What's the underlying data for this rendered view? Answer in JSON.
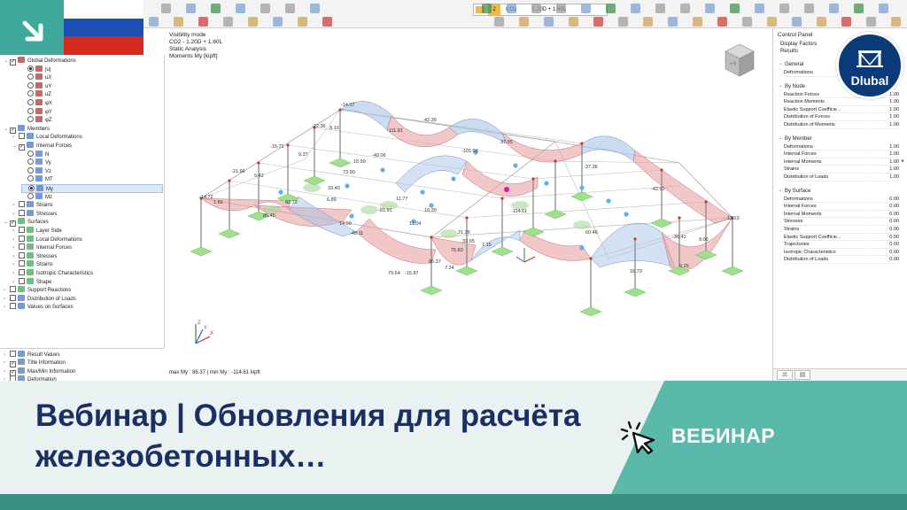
{
  "toolbar": {
    "load_combo": {
      "number": "2",
      "code": "CO2",
      "description": "1.20D + 1.60L"
    }
  },
  "navigator": {
    "rows": [
      {
        "label": "Global Deformations",
        "level": 0,
        "type": "check",
        "checked": true,
        "expanded": true,
        "icon_color": "#a83c3c"
      },
      {
        "label": "|u|",
        "level": 2,
        "type": "radio",
        "on": true,
        "icon_color": "#a83c3c"
      },
      {
        "label": "uX",
        "level": 2,
        "type": "radio",
        "on": false,
        "icon_color": "#a83c3c"
      },
      {
        "label": "uY",
        "level": 2,
        "type": "radio",
        "on": false,
        "icon_color": "#a83c3c"
      },
      {
        "label": "uZ",
        "level": 2,
        "type": "radio",
        "on": false,
        "icon_color": "#a83c3c"
      },
      {
        "label": "φX",
        "level": 2,
        "type": "radio",
        "on": false,
        "icon_color": "#a83c3c"
      },
      {
        "label": "φY",
        "level": 2,
        "type": "radio",
        "on": false,
        "icon_color": "#a83c3c"
      },
      {
        "label": "φZ",
        "level": 2,
        "type": "radio",
        "on": false,
        "icon_color": "#a83c3c"
      },
      {
        "label": "Members",
        "level": 0,
        "type": "check",
        "checked": true,
        "expanded": true,
        "icon_color": "#4a78c8"
      },
      {
        "label": "Local Deformations",
        "level": 1,
        "type": "check",
        "checked": false,
        "expanded": false,
        "icon_color": "#4a78c8"
      },
      {
        "label": "Internal Forces",
        "level": 1,
        "type": "check",
        "checked": true,
        "expanded": true,
        "icon_color": "#4a78c8"
      },
      {
        "label": "N",
        "level": 2,
        "type": "radio",
        "on": false,
        "icon_color": "#4a78c8"
      },
      {
        "label": "Vy",
        "level": 2,
        "type": "radio",
        "on": false,
        "icon_color": "#4a78c8"
      },
      {
        "label": "Vz",
        "level": 2,
        "type": "radio",
        "on": false,
        "icon_color": "#4a78c8"
      },
      {
        "label": "MT",
        "level": 2,
        "type": "radio",
        "on": false,
        "icon_color": "#4a78c8"
      },
      {
        "label": "My",
        "level": 2,
        "type": "radio",
        "on": true,
        "selected": true,
        "icon_color": "#4a78c8"
      },
      {
        "label": "Mz",
        "level": 2,
        "type": "radio",
        "on": false,
        "icon_color": "#4a78c8"
      },
      {
        "label": "Strains",
        "level": 1,
        "type": "check",
        "checked": false,
        "expanded": false,
        "icon_color": "#4a78c8"
      },
      {
        "label": "Stresses",
        "level": 1,
        "type": "check",
        "checked": false,
        "expanded": false,
        "icon_color": "#4a78c8"
      },
      {
        "label": "Surfaces",
        "level": 0,
        "type": "check",
        "checked": true,
        "expanded": true,
        "icon_color": "#3fa85a"
      },
      {
        "label": "Layer Side",
        "level": 1,
        "type": "check",
        "checked": false,
        "expanded": false,
        "icon_color": "#3fa85a"
      },
      {
        "label": "Local Deformations",
        "level": 1,
        "type": "check",
        "checked": false,
        "expanded": false,
        "icon_color": "#3fa85a"
      },
      {
        "label": "Internal Forces",
        "level": 1,
        "type": "check",
        "checked": false,
        "expanded": false,
        "icon_color": "#3fa85a"
      },
      {
        "label": "Stresses",
        "level": 1,
        "type": "check",
        "checked": false,
        "expanded": false,
        "icon_color": "#3fa85a"
      },
      {
        "label": "Strains",
        "level": 1,
        "type": "check",
        "checked": false,
        "expanded": false,
        "icon_color": "#3fa85a"
      },
      {
        "label": "Isotropic Characteristics",
        "level": 1,
        "type": "check",
        "checked": false,
        "expanded": false,
        "icon_color": "#3fa85a"
      },
      {
        "label": "Shape",
        "level": 1,
        "type": "check",
        "checked": false,
        "expanded": false,
        "icon_color": "#3fa85a"
      },
      {
        "label": "Support Reactions",
        "level": 0,
        "type": "check",
        "checked": false,
        "expanded": false,
        "icon_color": "#3fa85a"
      },
      {
        "label": "Distribution of Loads",
        "level": 0,
        "type": "check",
        "checked": false,
        "expanded": false,
        "icon_color": "#4a78c8"
      },
      {
        "label": "Values on Surfaces",
        "level": 0,
        "type": "check",
        "checked": false,
        "expanded": false,
        "icon_color": "#4a78c8"
      }
    ],
    "bottom_rows": [
      {
        "label": "Result Values",
        "checked": false,
        "expanded": false
      },
      {
        "label": "Title Information",
        "checked": true,
        "expanded": false
      },
      {
        "label": "Max/Min Information",
        "checked": true,
        "expanded": false
      },
      {
        "label": "Deformation",
        "checked": false,
        "expanded": false
      }
    ]
  },
  "view": {
    "info_lines": [
      "Visibility mode",
      "CO2 - 1.20D + 1.60L",
      "Static Analysis",
      "Moments My [kipft]"
    ],
    "maxmin": "max My : 86.37 | min My : -114.61 kipft",
    "value_labels": [
      "-14.07",
      "-22.36",
      "8.10",
      "42.35",
      "-111.81",
      "37.95",
      "-101.00",
      "-37.28",
      "-15.71",
      "9.37",
      "-49.06",
      "16.99",
      "-21.66",
      "9.42",
      "73.90",
      "33.40",
      "-14.72",
      "1.66",
      "82.72",
      "85.45",
      "6.89",
      "11.77",
      "-81.91",
      "-114.61",
      "-42.91",
      "16.30",
      "-30.41",
      "9.06",
      "-13.13",
      "14.00",
      "-48.11",
      "11.04",
      "33.95",
      "7.15",
      "86.37",
      "75.83",
      "7.24",
      "79.64",
      "-15.87",
      "16.79",
      "9.25",
      "60.46",
      "21.36"
    ]
  },
  "control_panel": {
    "title": "Control Panel",
    "sub1": "Display Factors",
    "sub2": "Results",
    "sections": [
      {
        "title": "General",
        "rows": [
          {
            "label": "Deformations",
            "value": ""
          }
        ]
      },
      {
        "title": "By Node",
        "rows": [
          {
            "label": "Reaction Forces",
            "value": "1.00"
          },
          {
            "label": "Reaction Moments",
            "value": "1.00"
          },
          {
            "label": "Elastic Support Coefficie...",
            "value": "1.00"
          },
          {
            "label": "Distribution of Forces",
            "value": "1.00"
          },
          {
            "label": "Distribution of Moments",
            "value": "1.00"
          }
        ]
      },
      {
        "title": "By Member",
        "rows": [
          {
            "label": "Deformations",
            "value": "1.00"
          },
          {
            "label": "Internal Forces",
            "value": "1.00"
          },
          {
            "label": "Internal Moments",
            "value": "1.00"
          },
          {
            "label": "Strains",
            "value": "1.00"
          },
          {
            "label": "Distribution of Loads",
            "value": "1.00"
          }
        ]
      },
      {
        "title": "By Surface",
        "rows": [
          {
            "label": "Deformations",
            "value": "0.00"
          },
          {
            "label": "Internal Forces",
            "value": "0.00"
          },
          {
            "label": "Internal Moments",
            "value": "0.00"
          },
          {
            "label": "Stresses",
            "value": "0.00"
          },
          {
            "label": "Strains",
            "value": "0.00"
          },
          {
            "label": "Elastic Support Coefficie...",
            "value": "0.00"
          },
          {
            "label": "Trajectories",
            "value": "0.00"
          },
          {
            "label": "Isotropic Characteristics",
            "value": "0.00"
          },
          {
            "label": "Distribution of Loads",
            "value": "0.00"
          }
        ]
      }
    ]
  },
  "logo": {
    "text": "Dlubal"
  },
  "banner": {
    "title": "Вебинар | Обновления для расчёта железобетонных…",
    "cta_label": "ВЕБИНАР"
  },
  "colors": {
    "teal": "#3fa99b",
    "teal_dark": "#3a8f84",
    "navy": "#1b2f63",
    "logo_blue": "#0a3a78",
    "diagram_pos": "#e8a2a2",
    "diagram_neg": "#a9c3e6",
    "support_green": "#9fe08f"
  }
}
